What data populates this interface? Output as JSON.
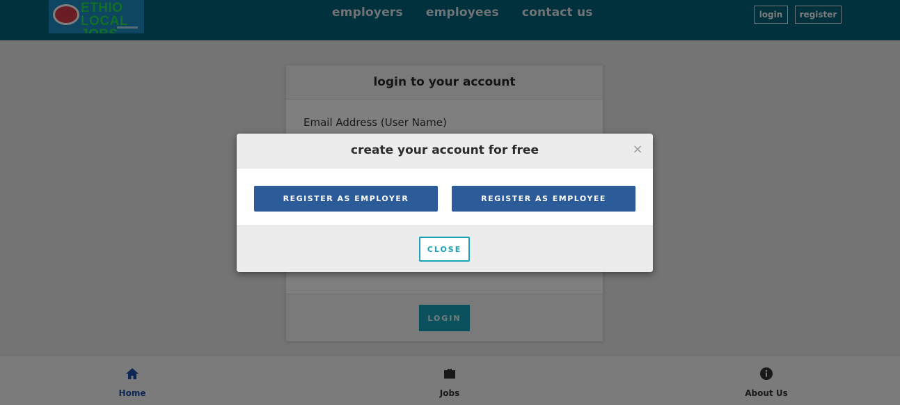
{
  "header": {
    "logo_text": "ETHIO LOCAL JOBS",
    "nav": [
      "employers",
      "employees",
      "contact us"
    ],
    "login_label": "login",
    "register_label": "register"
  },
  "login_card": {
    "title": "login to your account",
    "email_label": "Email Address (User Name)",
    "login_button": "LOGIN"
  },
  "modal": {
    "title": "create your account for free",
    "close_x": "×",
    "register_employer": "REGISTER AS EMPLOYER",
    "register_employee": "REGISTER AS EMPLOYEE",
    "close_button": "CLOSE"
  },
  "bottom_nav": {
    "items": [
      {
        "label": "Home",
        "icon": "home-icon"
      },
      {
        "label": "Jobs",
        "icon": "briefcase-icon"
      },
      {
        "label": "About Us",
        "icon": "info-icon"
      }
    ]
  },
  "colors": {
    "header_bg": "#05627d",
    "primary_button": "#2c5b99",
    "accent_teal": "#17a3ba",
    "active_nav": "#1e4fa8"
  }
}
